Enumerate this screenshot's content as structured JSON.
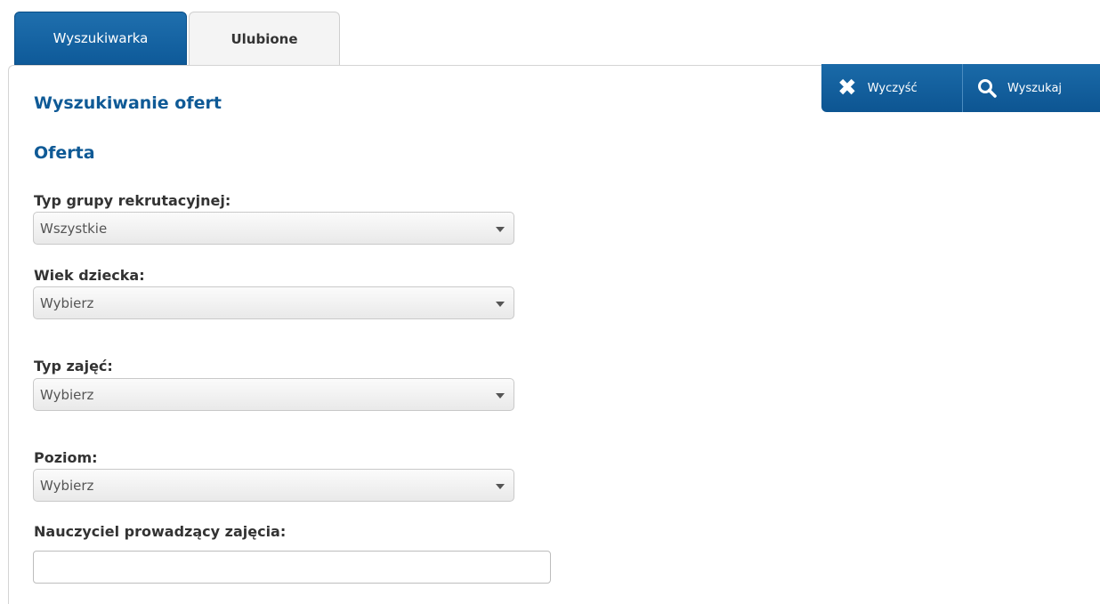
{
  "tabs": [
    {
      "label": "Wyszukiwarka",
      "active": true
    },
    {
      "label": "Ulubione",
      "active": false
    }
  ],
  "toolbar": {
    "clear_label": "Wyczyść",
    "clear_icon": "close-icon",
    "search_label": "Wyszukaj",
    "search_icon": "search-icon"
  },
  "page": {
    "title": "Wyszukiwanie ofert",
    "section": "Oferta"
  },
  "fields": {
    "group_type": {
      "label": "Typ grupy rekrutacyjnej:",
      "value": "Wszystkie"
    },
    "child_age": {
      "label": "Wiek dziecka:",
      "value": "Wybierz"
    },
    "class_type": {
      "label": "Typ zajęć:",
      "value": "Wybierz"
    },
    "level": {
      "label": "Poziom:",
      "value": "Wybierz"
    },
    "teacher": {
      "label": "Nauczyciel prowadzący zajęcia:",
      "value": ""
    }
  },
  "colors": {
    "accent": "#0f5a96",
    "tab_active_bg": "#1a6aa8",
    "text": "#333333"
  }
}
